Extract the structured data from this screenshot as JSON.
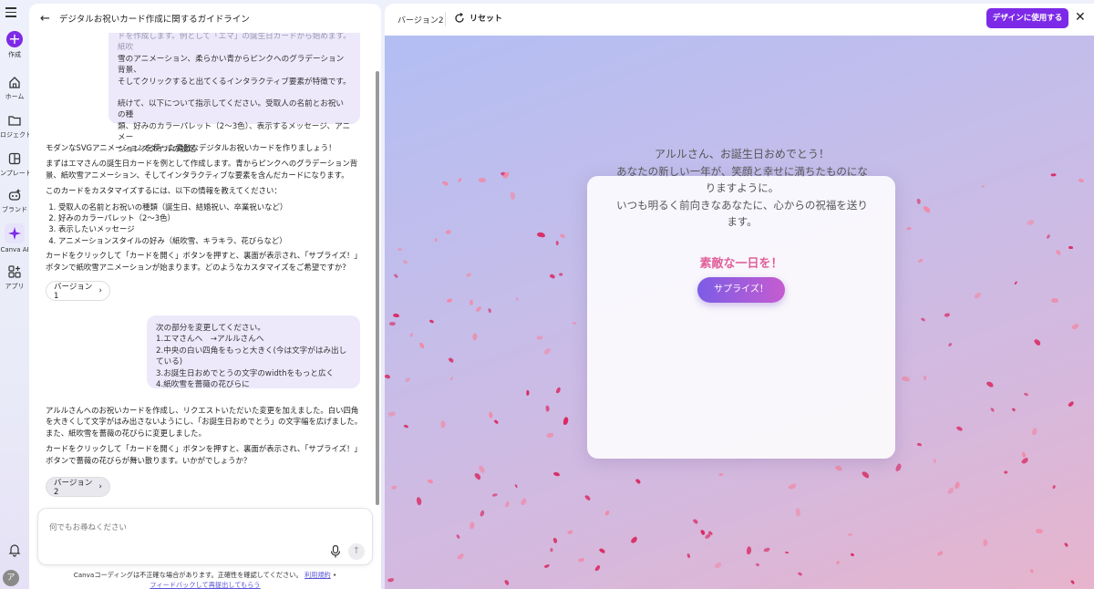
{
  "rail": {
    "items": [
      {
        "label": "作成"
      },
      {
        "label": "ホーム"
      },
      {
        "label": "ロジェクト"
      },
      {
        "label": "ンプレート"
      },
      {
        "label": "ブランド"
      },
      {
        "label": "Canva AI"
      },
      {
        "label": "アプリ"
      }
    ],
    "avatar": "ア"
  },
  "chat": {
    "title": "デジタルお祝いカード作成に関するガイドライン",
    "bubble1": {
      "faded": "ドを作成します。例として「エマ」の誕生日カードから始めます。紙吹",
      "line1": "雪のアニメーション、柔らかい青からピンクへのグラデーション背景、",
      "line2": "そしてクリックすると出てくるインタラクティブ要素が特徴です。",
      "line3": "続けて、以下について指示してください。受取人の名前とお祝いの種",
      "line4": "類、好みのカラーパレット（2〜3色）、表示するメッセージ、アニメー",
      "line5": "ションスタイルの設定"
    },
    "ai1": {
      "p1": "モダンなSVGアニメーションを使った素敵なデジタルお祝いカードを作りましょう！",
      "p2": "まずはエマさんの誕生日カードを例として作成します。青からピンクへのグラデーション背景、紙吹雪アニメーション、そしてインタラクティブな要素を含んだカードになります。",
      "p3": "このカードをカスタマイズするには、以下の情報を教えてください：",
      "list": [
        "受取人の名前とお祝いの種類（誕生日、結婚祝い、卒業祝いなど）",
        "好みのカラーパレット（2〜3色）",
        "表示したいメッセージ",
        "アニメーションスタイルの好み（紙吹雪、キラキラ、花びらなど）"
      ],
      "p4": "カードをクリックして「カードを開く」ボタンを押すと、裏面が表示され、「サプライズ！」ボタンで紙吹雪アニメーションが始まります。どのようなカスタマイズをご希望ですか？"
    },
    "version1": "バージョン1",
    "bubble2": {
      "line1": "次の部分を変更してください。",
      "line2": "1.エマさんへ　→アルルさんへ",
      "line3": "2.中央の白い四角をもっと大きく(今は文字がはみ出している)",
      "line4": "3.お誕生日おめでとうの文字のwidthをもっと広く",
      "line5": "4.紙吹雪を薔薇の花びらに"
    },
    "ai2": {
      "p1": "アルルさんへのお祝いカードを作成し、リクエストいただいた変更を加えました。白い四角を大きくして文字がはみ出さないようにし、「お誕生日おめでとう」の文字幅を広げました。また、紙吹雪を薔薇の花びらに変更しました。",
      "p2": "カードをクリックして「カードを開く」ボタンを押すと、裏面が表示され、「サプライズ！」ボタンで薔薇の花びらが舞い散ります。いかがでしょうか？"
    },
    "version2": "バージョン2",
    "input_placeholder": "何でもお尋ねください",
    "disclaimer": "Canvaコーディングは不正確な場合があります。正確性を確認してください。",
    "terms_link": "利用規約",
    "feedback_link": "フィードバックして再提出してもらう"
  },
  "preview": {
    "version": "バージョン2",
    "reset": "リセット",
    "use_button": "デザインに使用する",
    "greeting_line1": "アルルさん、お誕生日おめでとう！",
    "greeting_line2": "あなたの新しい一年が、笑顔と幸せに満ちたものになりますように。",
    "greeting_line3": "いつも明るく前向きなあなたに、心からの祝福を送ります。",
    "day_text": "素敵な一日を！",
    "surprise_button": "サプライズ！"
  },
  "colors": {
    "accent": "#7d2ae8",
    "petal_dark": "#d9265f",
    "petal_light": "#f08aa8"
  }
}
